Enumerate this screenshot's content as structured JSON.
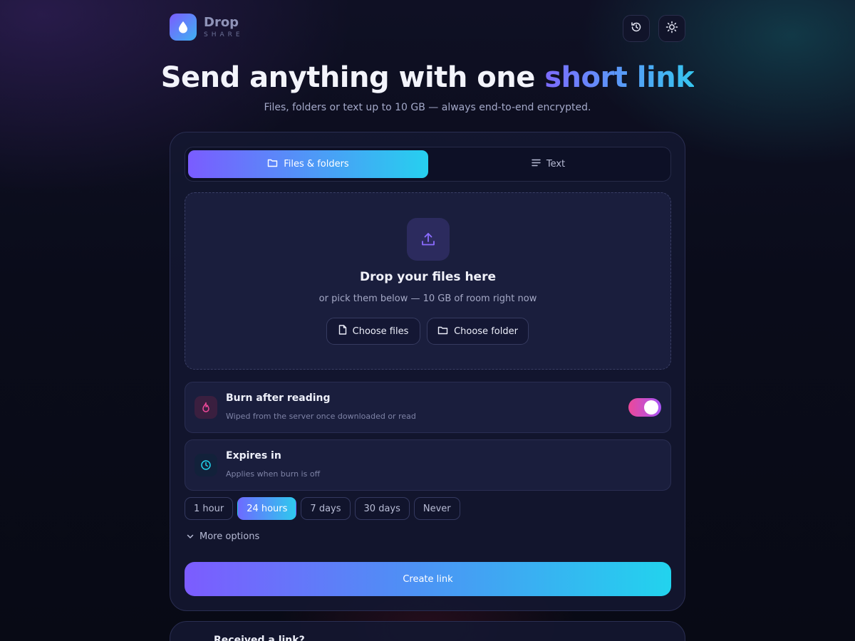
{
  "app": {
    "name": "Drop",
    "subtitle": "SHARE",
    "logo_icon": "droplet-icon",
    "accent_gradient": [
      "#7b5cff",
      "#3fb2f2"
    ]
  },
  "header": {
    "history_icon": "history-icon",
    "theme_icon": "sun-icon"
  },
  "hero": {
    "title_prefix": "Send anything with one ",
    "title_accent": "short link",
    "subtitle": "Files, folders or text up to 10 GB — always end-to-end encrypted."
  },
  "tabs": [
    {
      "label": "Files & folders",
      "icon": "folder-icon",
      "active": true
    },
    {
      "label": "Text",
      "icon": "text-lines-icon",
      "active": false
    }
  ],
  "dropzone": {
    "icon": "upload-icon",
    "title": "Drop your files here",
    "subtitle": "or pick them below — 10 GB of room right now",
    "choose_files_label": "Choose files",
    "choose_folder_label": "Choose folder"
  },
  "options": {
    "burn": {
      "title": "Burn after reading",
      "description": "Wiped from the server once downloaded or read",
      "icon": "flame-icon",
      "enabled": true,
      "color": "#ec4899"
    },
    "expires": {
      "title": "Expires in",
      "description": "Applies when burn is off",
      "icon": "clock-icon",
      "color": "#22d3ee"
    }
  },
  "expiry_choices": [
    "1 hour",
    "24 hours",
    "7 days",
    "30 days",
    "Never"
  ],
  "expiry_selected": "24 hours",
  "more_options_label": "More options",
  "create_label": "Create link",
  "received": {
    "title": "Received a link?"
  }
}
